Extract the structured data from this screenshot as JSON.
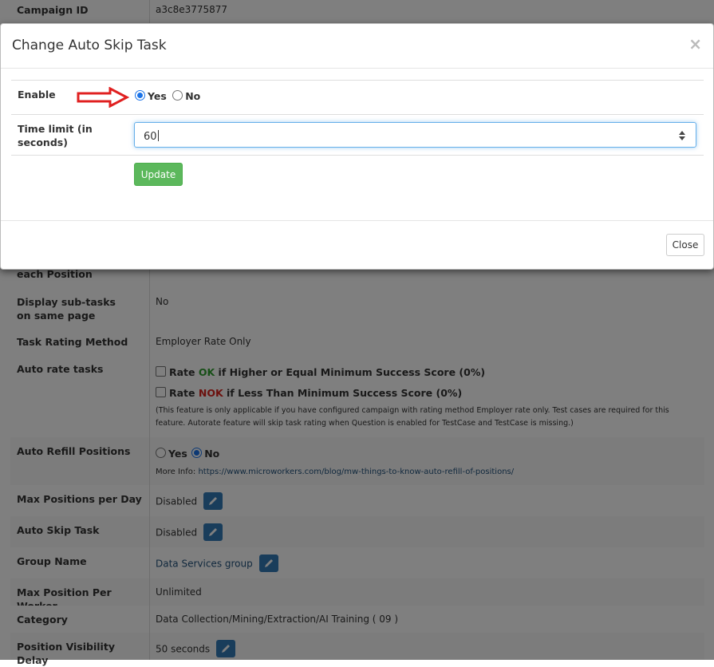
{
  "background": {
    "campaign_id_label": "Campaign ID",
    "campaign_id_value": "a3c8e3775877",
    "each_position_label": "each Position",
    "display_subtasks_label": "Display sub-tasks on same page",
    "display_subtasks_value": "No",
    "task_rating_label": "Task Rating Method",
    "task_rating_value": "Employer Rate Only",
    "auto_rate_label": "Auto rate tasks",
    "auto_rate_ok_prefix": "Rate",
    "auto_rate_ok_word": "OK",
    "auto_rate_ok_suffix": "if Higher or Equal Minimum Success Score (0%)",
    "auto_rate_nok_prefix": "Rate",
    "auto_rate_nok_word": "NOK",
    "auto_rate_nok_suffix": "if Less Than Minimum Success Score (0%)",
    "auto_rate_note": "(This feature is only applicable if you have configured campaign with rating method Employer rate only. Test cases are required for this feature. Autorate feature will skip task rating when Question is enabled for TestCase and TestCase is missing.)",
    "auto_refill_label": "Auto Refill Positions",
    "auto_refill_yes": "Yes",
    "auto_refill_no": "No",
    "auto_refill_selected": "No",
    "more_info_label": "More Info:",
    "more_info_link": "https://www.microworkers.com/blog/mw-things-to-know-auto-refill-of-positions/",
    "max_positions_day_label": "Max Positions per Day",
    "max_positions_day_value": "Disabled",
    "auto_skip_label": "Auto Skip Task",
    "auto_skip_value": "Disabled",
    "group_name_label": "Group Name",
    "group_name_value": "Data Services group",
    "max_per_worker_label": "Max Position Per Worker",
    "max_per_worker_value": "Unlimited",
    "category_label": "Category",
    "category_value": "Data Collection/Mining/Extraction/AI Training ( 09 )",
    "visibility_delay_label": "Position Visibility Delay",
    "visibility_delay_value": "50 seconds"
  },
  "modal": {
    "title": "Change Auto Skip Task",
    "close_x": "×",
    "enable_label": "Enable",
    "enable_yes": "Yes",
    "enable_no": "No",
    "enable_selected": "Yes",
    "time_limit_label": "Time limit (in seconds)",
    "time_limit_value": "60",
    "update_button": "Update",
    "close_button": "Close"
  },
  "colors": {
    "accent": "#337ab7",
    "success": "#5cb85c",
    "ok_green": "#2e9e2e",
    "nok_red": "#d9221c",
    "arrow_red": "#e02020"
  },
  "icons": [
    "pencil-icon",
    "arrow-right-icon",
    "spinner-icon"
  ]
}
